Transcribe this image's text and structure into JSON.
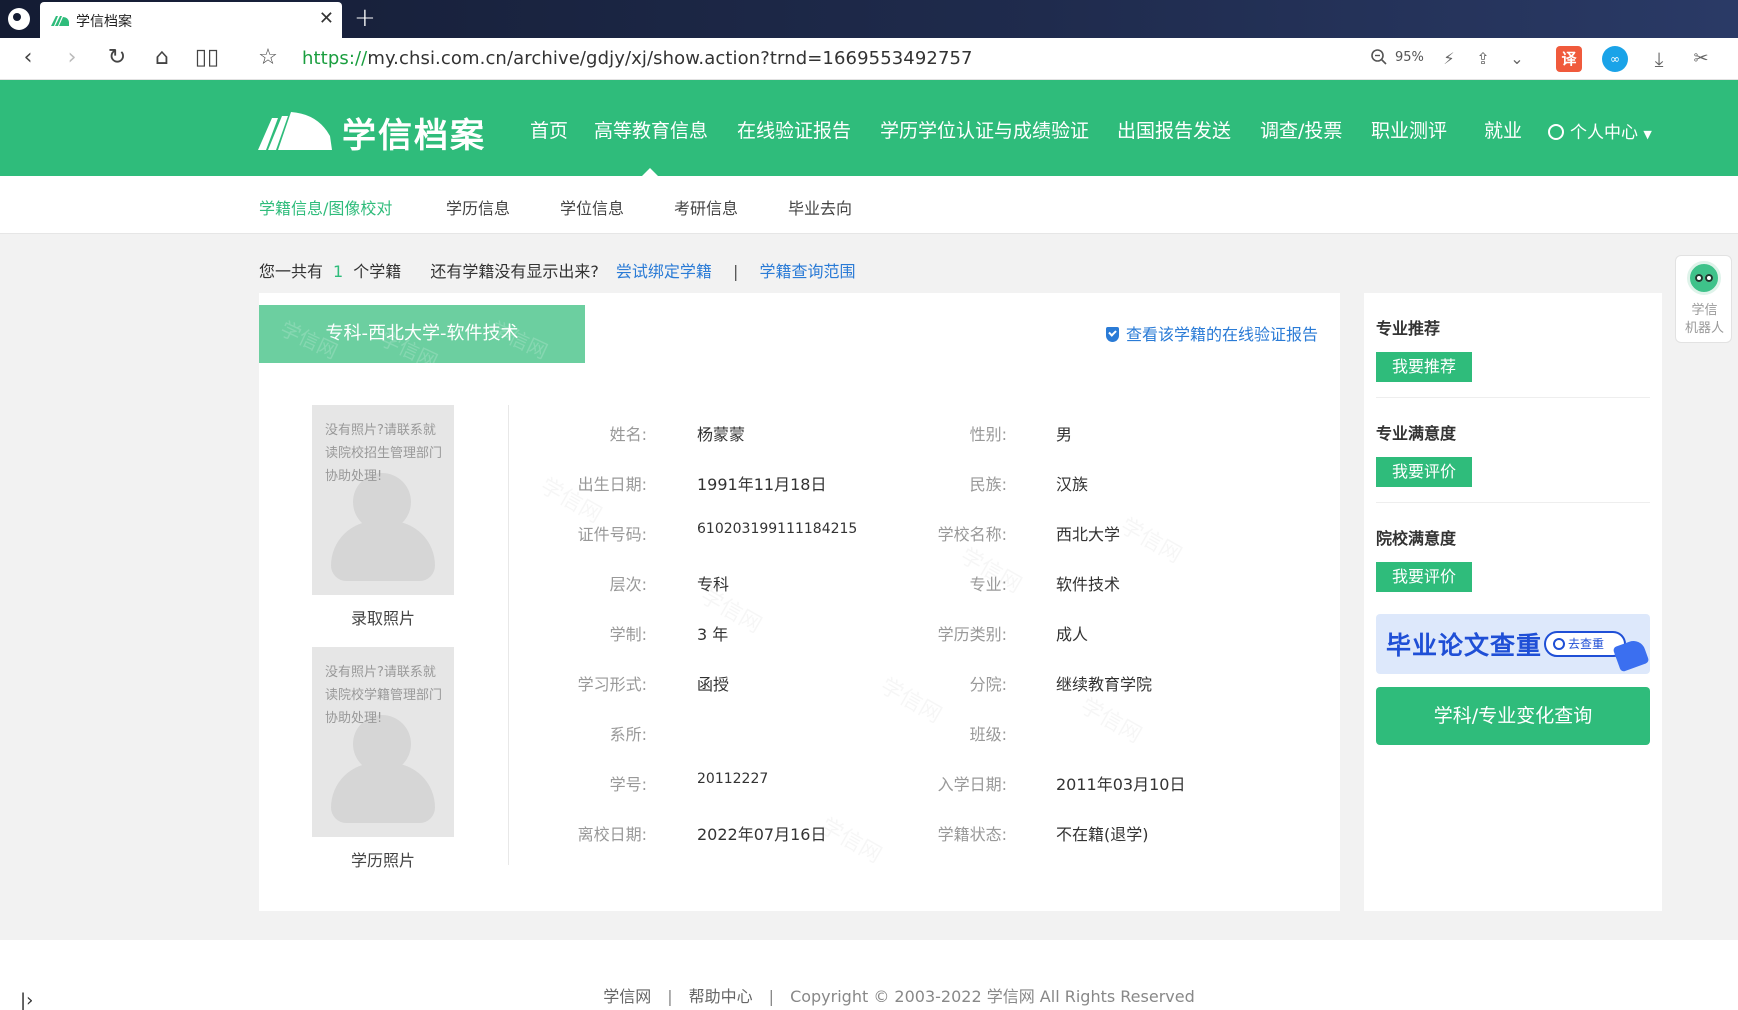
{
  "browser": {
    "tab_title": "学信档案",
    "url_scheme": "https://",
    "url_rest": "my.chsi.com.cn/archive/gdjy/xj/show.action?trnd=1669553492757",
    "zoom": "95%",
    "translate_label": "译"
  },
  "header": {
    "logo_text": "学信档案",
    "nav": [
      "首页",
      "高等教育信息",
      "在线验证报告",
      "学历学位认证与成绩验证",
      "出国报告发送",
      "调查/投票",
      "职业测评",
      "就业"
    ],
    "user_center": "个人中心"
  },
  "sub_nav": [
    "学籍信息/图像校对",
    "学历信息",
    "学位信息",
    "考研信息",
    "毕业去向"
  ],
  "summary": {
    "prefix": "您一共有",
    "count": "1",
    "suffix": "个学籍",
    "question": "还有学籍没有显示出来?",
    "bind_link": "尝试绑定学籍",
    "separator": "|",
    "scope_link": "学籍查询范围"
  },
  "record": {
    "tab_label": "专科-西北大学-软件技术",
    "watermark": "学信网",
    "verify_link": "查看该学籍的在线验证报告",
    "photos": [
      {
        "note": "没有照片?请联系就读院校招生管理部门协助处理!",
        "caption": "录取照片"
      },
      {
        "note": "没有照片?请联系就读院校学籍管理部门协助处理!",
        "caption": "学历照片"
      }
    ],
    "fields_left": [
      {
        "label": "姓名:",
        "value": "杨蒙蒙"
      },
      {
        "label": "出生日期:",
        "value": "1991年11月18日"
      },
      {
        "label": "证件号码:",
        "value": "610203199111184215"
      },
      {
        "label": "层次:",
        "value": "专科"
      },
      {
        "label": "学制:",
        "value": "3 年"
      },
      {
        "label": "学习形式:",
        "value": "函授"
      },
      {
        "label": "系所:",
        "value": ""
      },
      {
        "label": "学号:",
        "value": "20112227"
      },
      {
        "label": "离校日期:",
        "value": "2022年07月16日"
      }
    ],
    "fields_right": [
      {
        "label": "性别:",
        "value": "男"
      },
      {
        "label": "民族:",
        "value": "汉族"
      },
      {
        "label": "学校名称:",
        "value": "西北大学"
      },
      {
        "label": "专业:",
        "value": "软件技术"
      },
      {
        "label": "学历类别:",
        "value": "成人"
      },
      {
        "label": "分院:",
        "value": "继续教育学院"
      },
      {
        "label": "班级:",
        "value": ""
      },
      {
        "label": "入学日期:",
        "value": "2011年03月10日"
      },
      {
        "label": "学籍状态:",
        "value": "不在籍(退学)"
      }
    ]
  },
  "side": {
    "sections": [
      {
        "title": "专业推荐",
        "button": "我要推荐"
      },
      {
        "title": "专业满意度",
        "button": "我要评价"
      },
      {
        "title": "院校满意度",
        "button": "我要评价"
      }
    ],
    "banner_text": "毕业论文查重",
    "banner_pill": "去查重",
    "big_button": "学科/专业变化查询"
  },
  "robot": {
    "label_line1": "学信",
    "label_line2": "机器人"
  },
  "footer": {
    "link1": "学信网",
    "sep": "|",
    "link2": "帮助中心",
    "copyright": "Copyright © 2003-2022 学信网 All Rights Reserved"
  },
  "colors": {
    "brand_green": "#2fbc7b",
    "tab_green": "#6ccfa0",
    "link_blue": "#2a7bd6"
  }
}
